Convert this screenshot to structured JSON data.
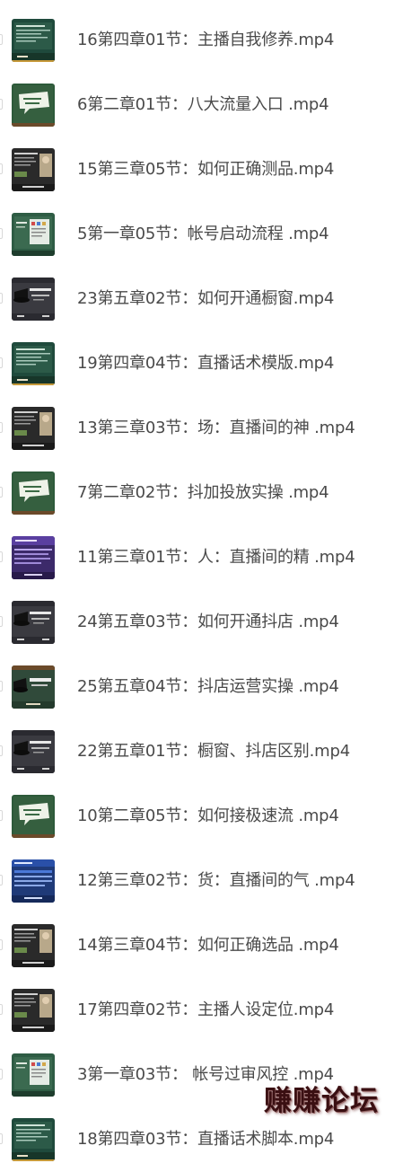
{
  "files": [
    {
      "name": "16第四章01节：主播自我修养.mp4",
      "thumb": "green-text-slide"
    },
    {
      "name": "6第二章01节：八大流量入口 .mp4",
      "thumb": "chalkboard-bubble"
    },
    {
      "name": "15第三章05节：如何正确测品.mp4",
      "thumb": "dark-slide-photo"
    },
    {
      "name": "5第一章05节：帐号启动流程 .mp4",
      "thumb": "chalkboard-chart"
    },
    {
      "name": "23第五章02节：如何开通橱窗.mp4",
      "thumb": "dark-hat-slide"
    },
    {
      "name": "19第四章04节：直播话术模版.mp4",
      "thumb": "green-text-slide"
    },
    {
      "name": "13第三章03节：场：直播间的神 .mp4",
      "thumb": "dark-slide-photo"
    },
    {
      "name": "7第二章02节：抖加投放实操 .mp4",
      "thumb": "chalkboard-bubble"
    },
    {
      "name": "11第三章01节：人：直播间的精 .mp4",
      "thumb": "purple-slide"
    },
    {
      "name": "24第五章03节：如何开通抖店 .mp4",
      "thumb": "dark-hat-slide"
    },
    {
      "name": "25第五章04节：抖店运营实操 .mp4",
      "thumb": "chalkboard-hat"
    },
    {
      "name": "22第五章01节：橱窗、抖店区别.mp4",
      "thumb": "dark-hat-slide"
    },
    {
      "name": "10第二章05节：如何接极速流 .mp4",
      "thumb": "chalkboard-bubble"
    },
    {
      "name": "12第三章02节：货：直播间的气 .mp4",
      "thumb": "blue-slide"
    },
    {
      "name": "14第三章04节：如何正确选品 .mp4",
      "thumb": "dark-slide-photo"
    },
    {
      "name": "17第四章02节：主播人设定位.mp4",
      "thumb": "dark-slide-photo"
    },
    {
      "name": "3第一章03节： 帐号过审风控 .mp4",
      "thumb": "chalkboard-chart"
    },
    {
      "name": "18第四章03节：直播话术脚本.mp4",
      "thumb": "green-text-slide"
    }
  ],
  "watermark": {
    "text": "赚赚论坛",
    "color": "#3a0f12"
  },
  "colors": {
    "filename_text": "#4a4a4a",
    "background": "#ffffff"
  }
}
